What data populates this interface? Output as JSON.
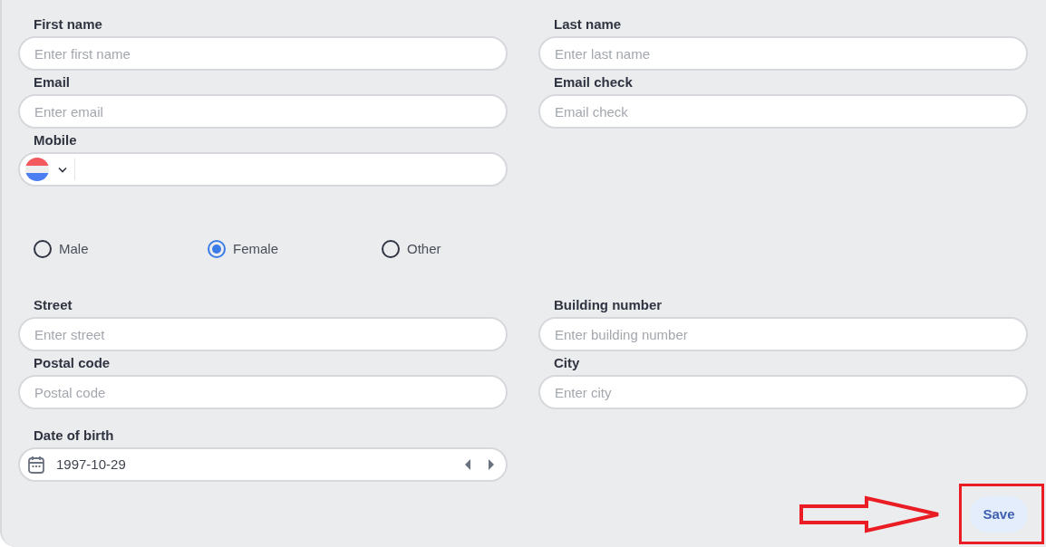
{
  "contact_fields": [
    {
      "kind": "text",
      "label": "First name",
      "placeholder": "Enter first name"
    },
    {
      "kind": "text",
      "label": "Last name",
      "placeholder": "Enter last name"
    },
    {
      "kind": "text",
      "label": "Email",
      "placeholder": "Enter email"
    },
    {
      "kind": "text",
      "label": "Email check",
      "placeholder": "Email check"
    },
    {
      "kind": "phone",
      "label": "Mobile"
    }
  ],
  "gender": [
    {
      "label": "Male",
      "selected": false
    },
    {
      "label": "Female",
      "selected": true
    },
    {
      "label": "Other",
      "selected": false
    }
  ],
  "address_fields": [
    {
      "kind": "text",
      "label": "Street",
      "placeholder": "Enter street"
    },
    {
      "kind": "text",
      "label": "Building number",
      "placeholder": "Enter building number"
    },
    {
      "kind": "text",
      "label": "Postal code",
      "placeholder": "Postal code"
    },
    {
      "kind": "text",
      "label": "City",
      "placeholder": "Enter city"
    }
  ],
  "date_of_birth": {
    "label": "Date of birth",
    "value": "1997-10-29"
  },
  "save_button": "Save",
  "annotation": {
    "arrow": true,
    "highlight_box": true
  }
}
